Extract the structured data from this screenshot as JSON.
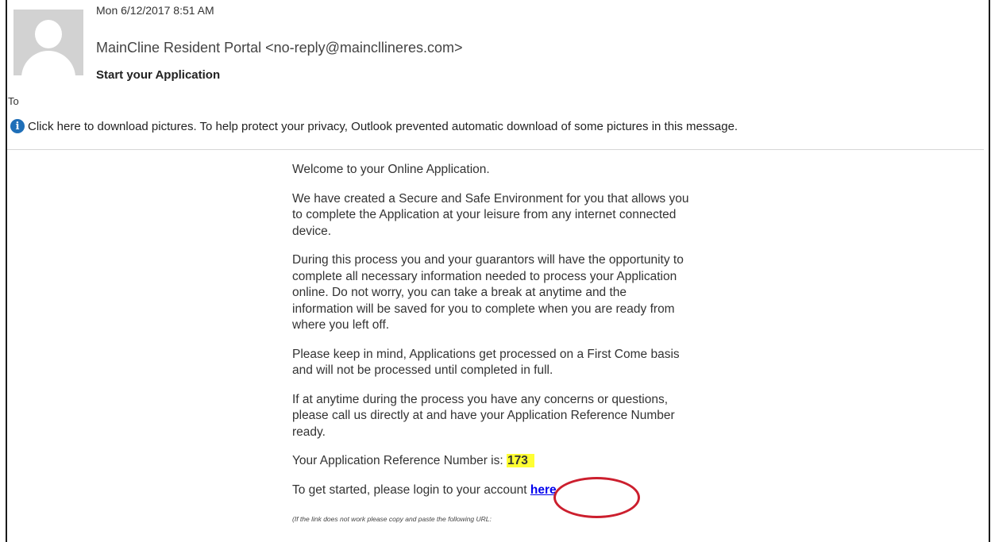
{
  "header": {
    "date": "Mon 6/12/2017 8:51 AM",
    "sender": "MainCline Resident Portal <no-reply@maincllineres.com>",
    "subject": "Start your Application",
    "to_label": "To"
  },
  "infobar": {
    "icon": "info-icon",
    "text": "Click here to download pictures. To help protect your privacy, Outlook prevented automatic download of some pictures in this message."
  },
  "body": {
    "welcome": "Welcome to your Online Application.",
    "para1": "We have created a Secure and Safe Environment for you that allows you to complete the Application at your leisure from any internet connected device.",
    "para2": "During this process you and your guarantors will have the opportunity to complete all necessary information needed to process your Application online. Do not worry, you can take a break at anytime and the information will be saved for you to complete when you are ready from where you left off.",
    "para3": "Please keep in mind, Applications get processed on a First Come basis and will not be processed until completed in full.",
    "para4": "If at anytime during the process you have any concerns or questions, please call us directly at and have your Application Reference Number ready.",
    "ref_label": "Your Application Reference Number is: ",
    "ref_number": "173",
    "login_text": "To get started, please login to your account ",
    "login_link": "here",
    "note": "(If the link does not work please copy and paste the following URL:"
  },
  "colors": {
    "highlight": "#ffff33",
    "annotation_circle": "#cc1f2e",
    "link": "#0000ee"
  }
}
